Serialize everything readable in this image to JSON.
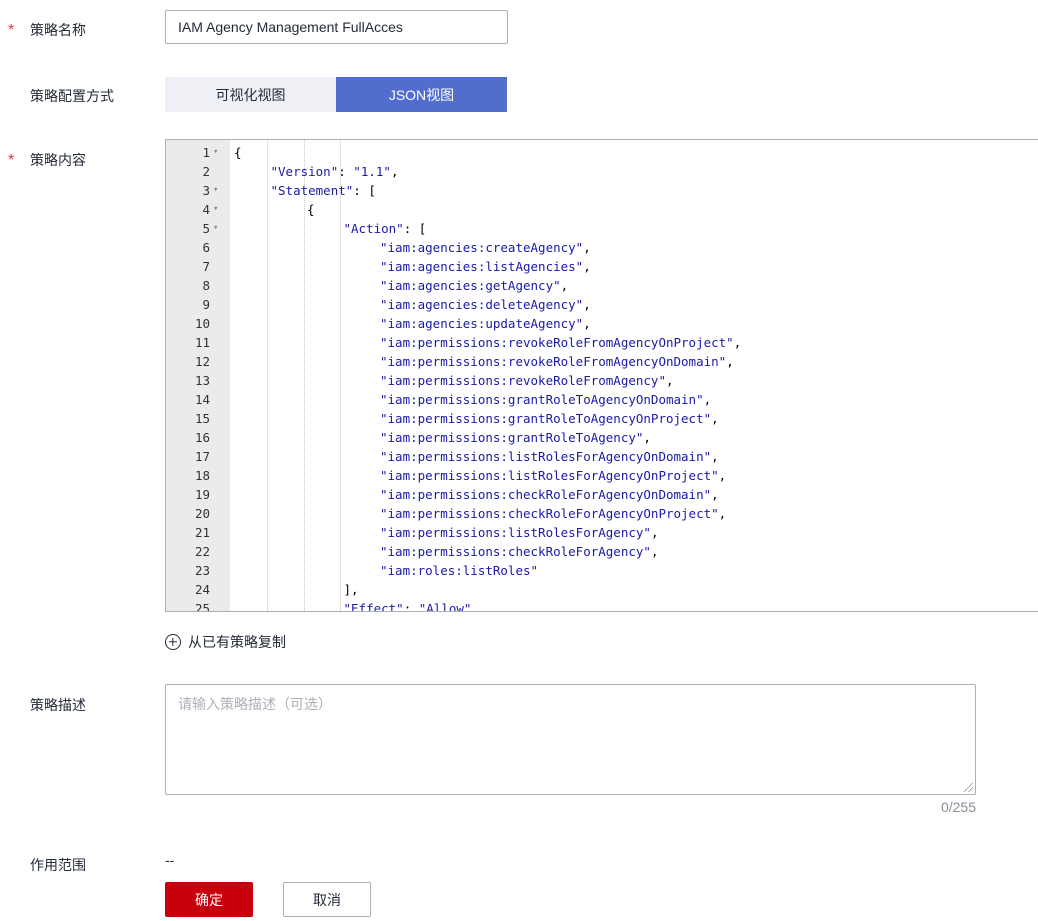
{
  "form": {
    "name_label": "策略名称",
    "name_value": "IAM Agency Management FullAcces",
    "config_label": "策略配置方式",
    "tabs": [
      "可视化视图",
      "JSON视图"
    ],
    "active_tab": "JSON视图",
    "content_label": "策略内容",
    "copy_link": "从已有策略复制",
    "desc_label": "策略描述",
    "desc_placeholder": "请输入策略描述（可选）",
    "desc_counter": "0/255",
    "scope_label": "作用范围",
    "scope_value": "--",
    "ok_button": "确定",
    "cancel_button": "取消",
    "required_mark": "*"
  },
  "code": [
    {
      "n": "1",
      "fold": true,
      "indent": 0,
      "text": "{"
    },
    {
      "n": "2",
      "fold": false,
      "indent": 1,
      "text": "\"Version\": \"1.1\","
    },
    {
      "n": "3",
      "fold": true,
      "indent": 1,
      "text": "\"Statement\": ["
    },
    {
      "n": "4",
      "fold": true,
      "indent": 2,
      "text": "{"
    },
    {
      "n": "5",
      "fold": true,
      "indent": 3,
      "text": "\"Action\": ["
    },
    {
      "n": "6",
      "fold": false,
      "indent": 4,
      "text": "\"iam:agencies:createAgency\","
    },
    {
      "n": "7",
      "fold": false,
      "indent": 4,
      "text": "\"iam:agencies:listAgencies\","
    },
    {
      "n": "8",
      "fold": false,
      "indent": 4,
      "text": "\"iam:agencies:getAgency\","
    },
    {
      "n": "9",
      "fold": false,
      "indent": 4,
      "text": "\"iam:agencies:deleteAgency\","
    },
    {
      "n": "10",
      "fold": false,
      "indent": 4,
      "text": "\"iam:agencies:updateAgency\","
    },
    {
      "n": "11",
      "fold": false,
      "indent": 4,
      "text": "\"iam:permissions:revokeRoleFromAgencyOnProject\","
    },
    {
      "n": "12",
      "fold": false,
      "indent": 4,
      "text": "\"iam:permissions:revokeRoleFromAgencyOnDomain\","
    },
    {
      "n": "13",
      "fold": false,
      "indent": 4,
      "text": "\"iam:permissions:revokeRoleFromAgency\","
    },
    {
      "n": "14",
      "fold": false,
      "indent": 4,
      "text": "\"iam:permissions:grantRoleToAgencyOnDomain\","
    },
    {
      "n": "15",
      "fold": false,
      "indent": 4,
      "text": "\"iam:permissions:grantRoleToAgencyOnProject\","
    },
    {
      "n": "16",
      "fold": false,
      "indent": 4,
      "text": "\"iam:permissions:grantRoleToAgency\","
    },
    {
      "n": "17",
      "fold": false,
      "indent": 4,
      "text": "\"iam:permissions:listRolesForAgencyOnDomain\","
    },
    {
      "n": "18",
      "fold": false,
      "indent": 4,
      "text": "\"iam:permissions:listRolesForAgencyOnProject\","
    },
    {
      "n": "19",
      "fold": false,
      "indent": 4,
      "text": "\"iam:permissions:checkRoleForAgencyOnDomain\","
    },
    {
      "n": "20",
      "fold": false,
      "indent": 4,
      "text": "\"iam:permissions:checkRoleForAgencyOnProject\","
    },
    {
      "n": "21",
      "fold": false,
      "indent": 4,
      "text": "\"iam:permissions:listRolesForAgency\","
    },
    {
      "n": "22",
      "fold": false,
      "indent": 4,
      "text": "\"iam:permissions:checkRoleForAgency\","
    },
    {
      "n": "23",
      "fold": false,
      "indent": 4,
      "text": "\"iam:roles:listRoles\""
    },
    {
      "n": "24",
      "fold": false,
      "indent": 3,
      "text": "],"
    },
    {
      "n": "25",
      "fold": false,
      "indent": 3,
      "text": "\"Effect\": \"Allow\""
    }
  ],
  "colors": {
    "accent": "#526ecc",
    "primary_button": "#c7000b",
    "required": "#e4393c",
    "code_string": "#1a1aa6"
  }
}
